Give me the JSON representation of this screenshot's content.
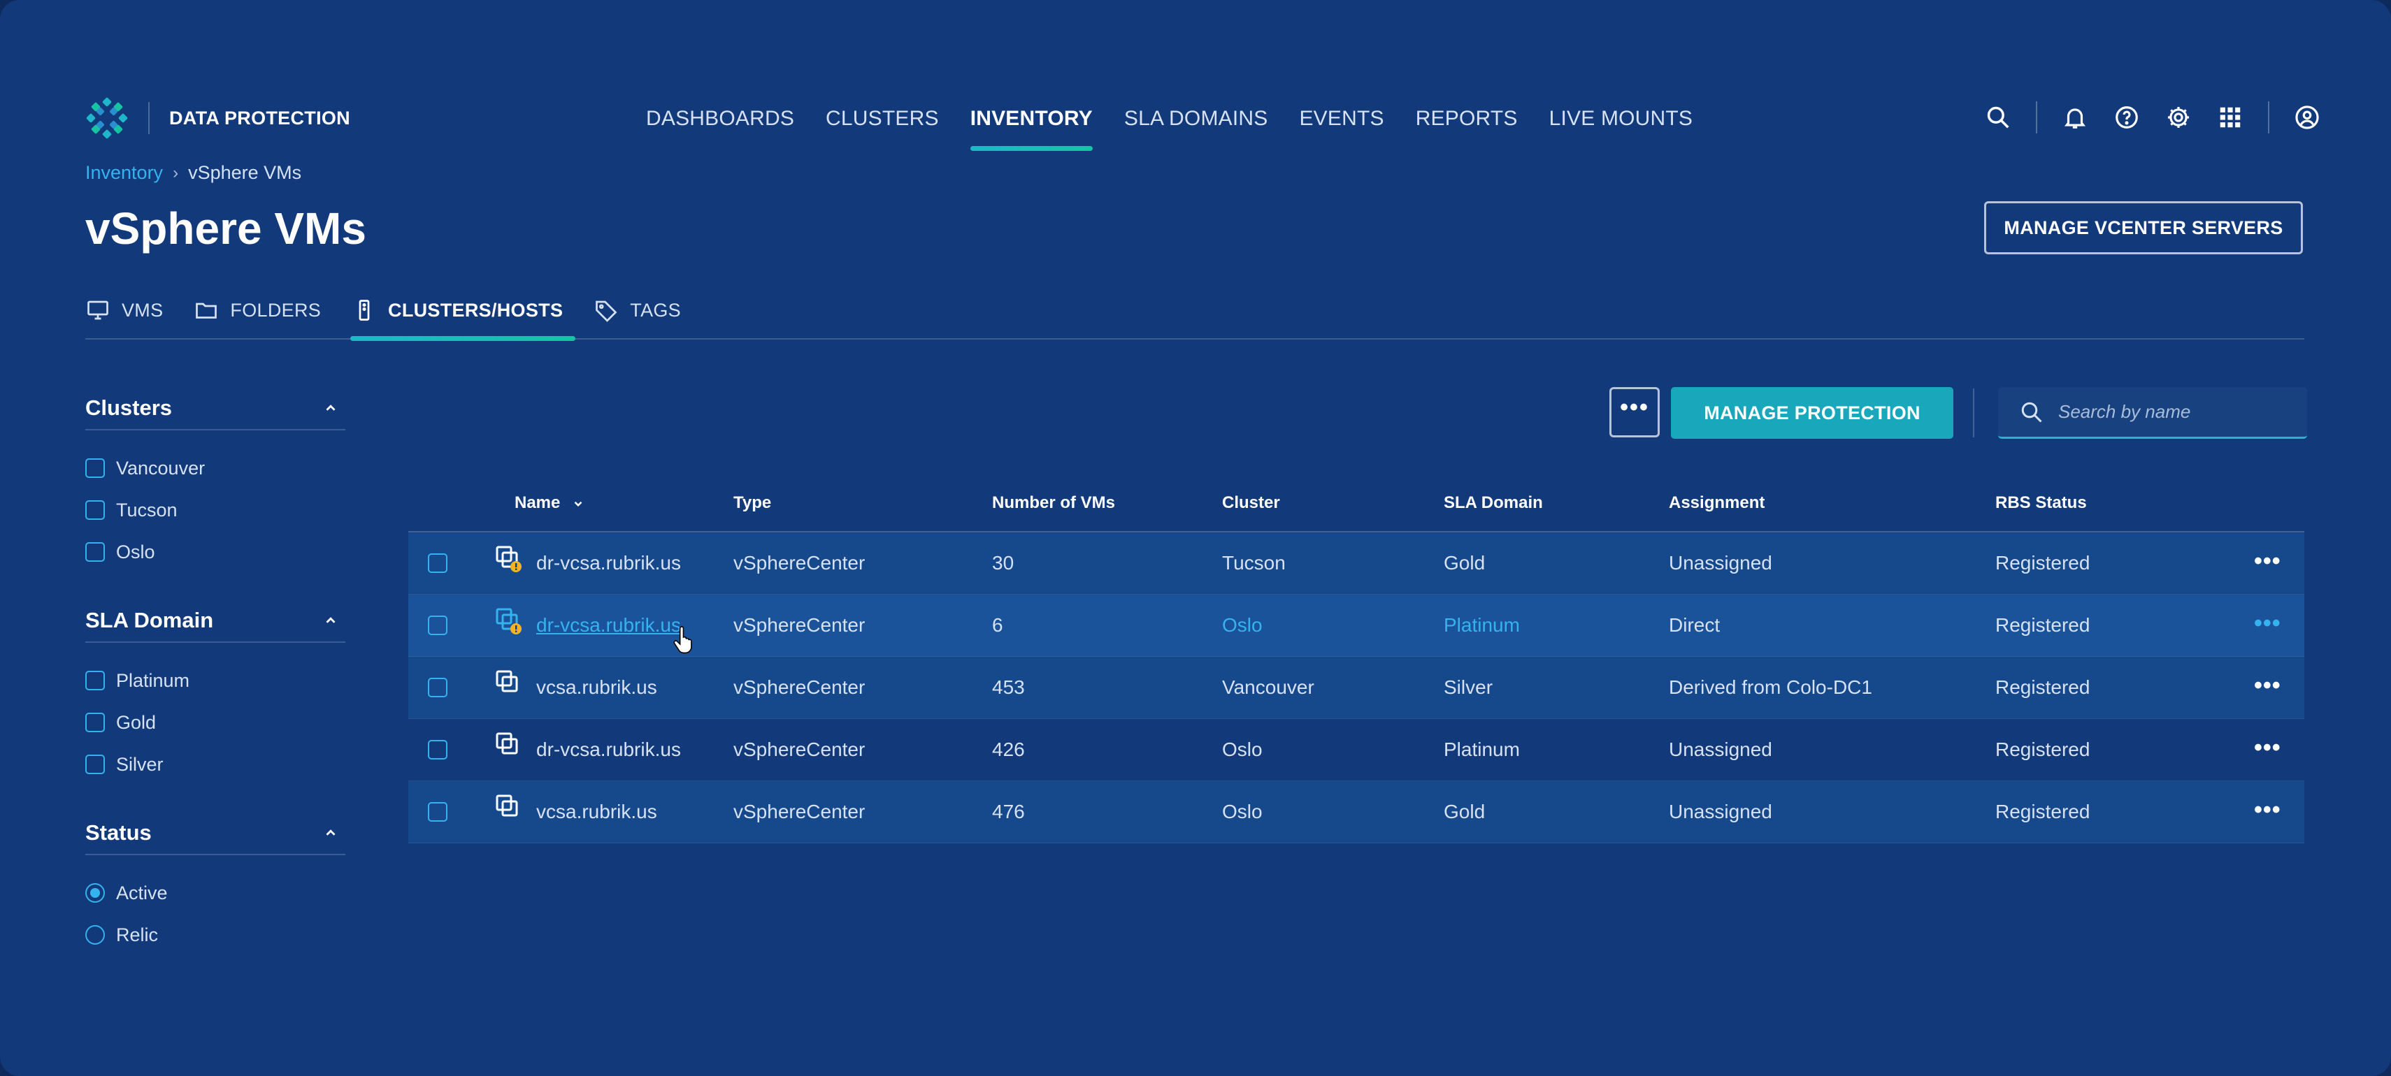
{
  "brand": {
    "name": "DATA PROTECTION"
  },
  "nav": {
    "items": [
      "DASHBOARDS",
      "CLUSTERS",
      "INVENTORY",
      "SLA DOMAINS",
      "EVENTS",
      "REPORTS",
      "LIVE MOUNTS"
    ],
    "active": "INVENTORY"
  },
  "toolbar_icons": [
    "search-icon",
    "bell-icon",
    "help-icon",
    "gear-icon",
    "apps-grid-icon",
    "user-icon"
  ],
  "breadcrumb": {
    "parent": "Inventory",
    "separator": "›",
    "current": "vSphere VMs"
  },
  "page_title": "vSphere VMs",
  "manage_vcenter_label": "MANAGE VCENTER SERVERS",
  "subtabs": [
    {
      "label": "VMS",
      "icon": "monitor-icon"
    },
    {
      "label": "FOLDERS",
      "icon": "folder-icon"
    },
    {
      "label": "CLUSTERS/HOSTS",
      "icon": "server-icon",
      "active": true
    },
    {
      "label": "TAGS",
      "icon": "tag-icon"
    }
  ],
  "filters": {
    "clusters": {
      "title": "Clusters",
      "options": [
        "Vancouver",
        "Tucson",
        "Oslo"
      ]
    },
    "sla": {
      "title": "SLA Domain",
      "options": [
        "Platinum",
        "Gold",
        "Silver"
      ]
    },
    "status": {
      "title": "Status",
      "options": [
        "Active",
        "Relic"
      ],
      "selected": "Active"
    }
  },
  "actions": {
    "more": "•••",
    "manage_protection": "MANAGE PROTECTION",
    "search_placeholder": "Search by name"
  },
  "table": {
    "headers": [
      "Name",
      "Type",
      "Number of VMs",
      "Cluster",
      "SLA Domain",
      "Assignment",
      "RBS Status"
    ],
    "rows": [
      {
        "name": "dr-vcsa.rubrik.us",
        "type": "vSphereCenter",
        "vms": "30",
        "cluster": "Tucson",
        "sla": "Gold",
        "assignment": "Unassigned",
        "rbs": "Registered",
        "warning": true
      },
      {
        "name": "dr-vcsa.rubrik.us",
        "type": "vSphereCenter",
        "vms": "6",
        "cluster": "Oslo",
        "sla": "Platinum",
        "assignment": "Direct",
        "rbs": "Registered",
        "warning": true
      },
      {
        "name": "vcsa.rubrik.us",
        "type": "vSphereCenter",
        "vms": "453",
        "cluster": "Vancouver",
        "sla": "Silver",
        "assignment": "Derived from Colo-DC1",
        "rbs": "Registered",
        "warning": false
      },
      {
        "name": "dr-vcsa.rubrik.us",
        "type": "vSphereCenter",
        "vms": "426",
        "cluster": "Oslo",
        "sla": "Platinum",
        "assignment": "Unassigned",
        "rbs": "Registered",
        "warning": false
      },
      {
        "name": "vcsa.rubrik.us",
        "type": "vSphereCenter",
        "vms": "476",
        "cluster": "Oslo",
        "sla": "Gold",
        "assignment": "Unassigned",
        "rbs": "Registered",
        "warning": false
      }
    ],
    "row_more": "•••"
  },
  "colors": {
    "accent": "#19a8bb",
    "link": "#35b3f0",
    "background": "#12397a",
    "warning": "#f5b324"
  }
}
